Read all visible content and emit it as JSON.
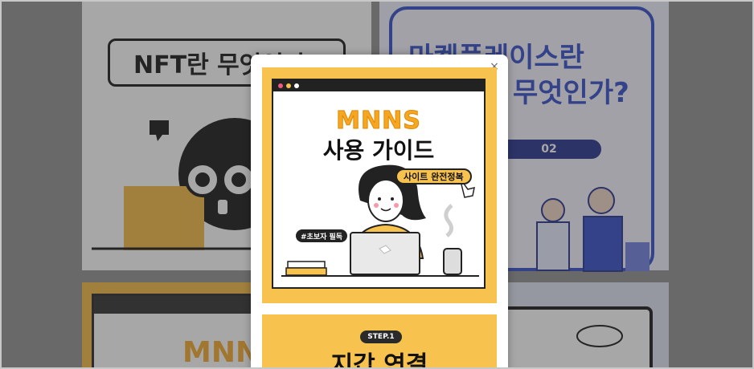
{
  "background": {
    "tiles": {
      "nft": {
        "title": "NFT란 무엇인가?"
      },
      "market": {
        "title_line1": "마켓플레이스란",
        "title_line2": "무엇인가?",
        "pill": "02"
      },
      "mnns_bg": {
        "title": "MNNS"
      }
    }
  },
  "modal": {
    "close_label": "×",
    "zoom_icon": "zoom-icon",
    "card": {
      "title": "MNNS",
      "subtitle": "사용 가이드",
      "tag_site": "사이트 완전정복",
      "tag_beginner": "#초보자 필독",
      "window_dots": [
        "#f05a7e",
        "#f7c24d",
        "#ffffff"
      ]
    },
    "card2": {
      "step": "STEP.1",
      "title": "지갑 연결"
    }
  },
  "colors": {
    "accent_yellow": "#f7c24d",
    "accent_orange": "#f5a623",
    "dark": "#222222",
    "brand_blue": "#2f49c9"
  }
}
